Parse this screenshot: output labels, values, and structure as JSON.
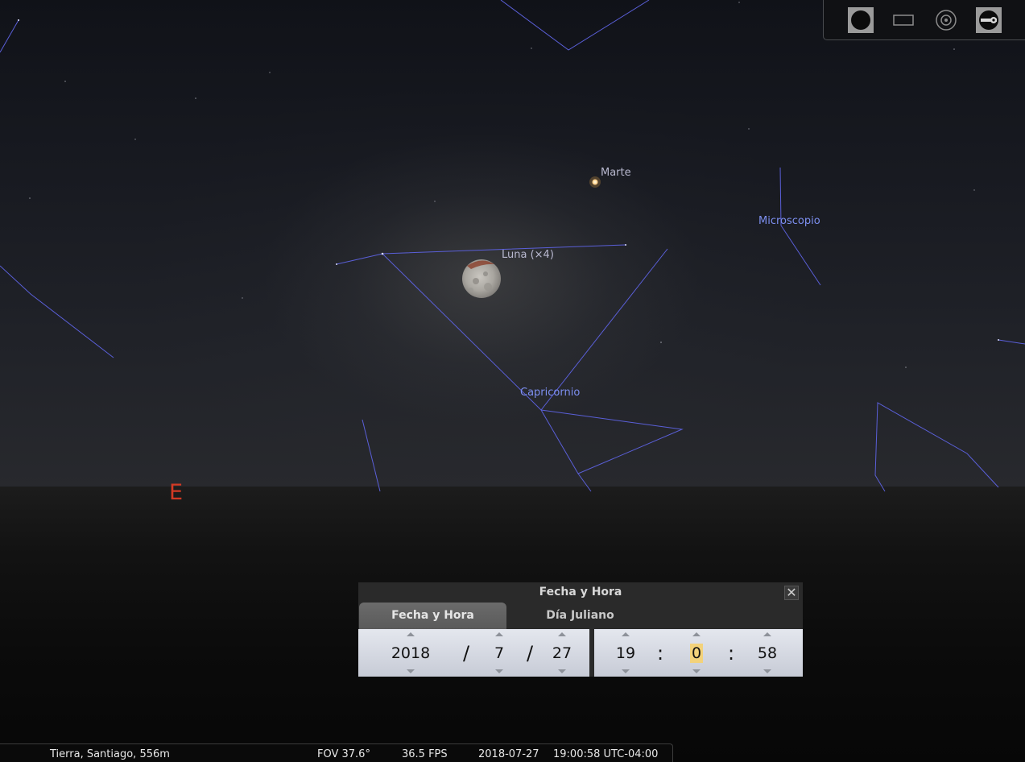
{
  "sky": {
    "constellations": [
      "Microscopio",
      "Capricornio"
    ],
    "planets": {
      "mars": "Marte",
      "moon": "Luna (×4)"
    },
    "cardinal": "E"
  },
  "toolbar": {
    "buttons": [
      "circle-icon",
      "rectangle-icon",
      "target-icon",
      "wrench-icon"
    ]
  },
  "dialog": {
    "title": "Fecha y Hora",
    "close": "✕",
    "tabs": [
      "Fecha y Hora",
      "Día Juliano"
    ],
    "date": {
      "year": "2018",
      "sep": "/",
      "month": "7",
      "day": "27"
    },
    "time": {
      "hour": "19",
      "sep": ":",
      "minute": "0",
      "second": "58"
    }
  },
  "status": {
    "location": "Tierra, Santiago, 556m",
    "fov": "FOV 37.6°",
    "fps": "36.5 FPS",
    "date": "2018-07-27",
    "time": "19:00:58 UTC-04:00"
  },
  "colors": {
    "constellation_line": "#5a5fd8",
    "constellation_label": "#7d8ff0",
    "cardinal": "#d23a24",
    "highlight": "#f3d27a"
  }
}
